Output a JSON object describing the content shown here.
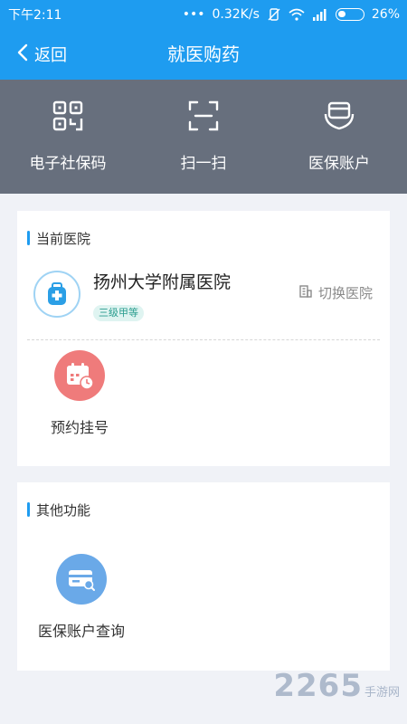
{
  "status_bar": {
    "time": "下午2:11",
    "dots": "•••",
    "speed": "0.32K/s",
    "battery": "26%"
  },
  "header": {
    "back_label": "返回",
    "title": "就医购药"
  },
  "quick_actions": [
    {
      "label": "电子社保码",
      "icon": "qr-code-icon"
    },
    {
      "label": "扫一扫",
      "icon": "scan-icon"
    },
    {
      "label": "医保账户",
      "icon": "wallet-hand-icon"
    }
  ],
  "current_hospital": {
    "section_title": "当前医院",
    "name": "扬州大学附属医院",
    "level": "三级甲等",
    "switch_label": "切换医院",
    "functions": [
      {
        "label": "预约挂号",
        "icon": "calendar-clock-icon"
      }
    ]
  },
  "other_functions": {
    "section_title": "其他功能",
    "functions": [
      {
        "label": "医保账户查询",
        "icon": "card-search-icon"
      }
    ]
  },
  "watermark": {
    "number": "2265",
    "text": "手游网"
  },
  "colors": {
    "primary": "#1e9cf0",
    "quickbar": "#676f7d",
    "background": "#f0f2f7",
    "appointment": "#ef7b7b",
    "account": "#6aa9e8"
  }
}
